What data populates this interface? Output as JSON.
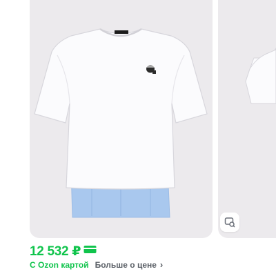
{
  "product": {
    "image_alt": "white-tshirt-with-blue-shirt-hem",
    "price": "12 532 ₽",
    "ozon_card_label": "С Ozon картой",
    "more_price_link": "Больше о цене",
    "chevron": "›"
  },
  "icons": {
    "search_by_photo": "image-search-icon",
    "ozon_card": "ozon-card-icon"
  },
  "colors": {
    "accent": "#10c44c",
    "image_bg": "#eceaed",
    "muted_text": "#5a5f66"
  }
}
